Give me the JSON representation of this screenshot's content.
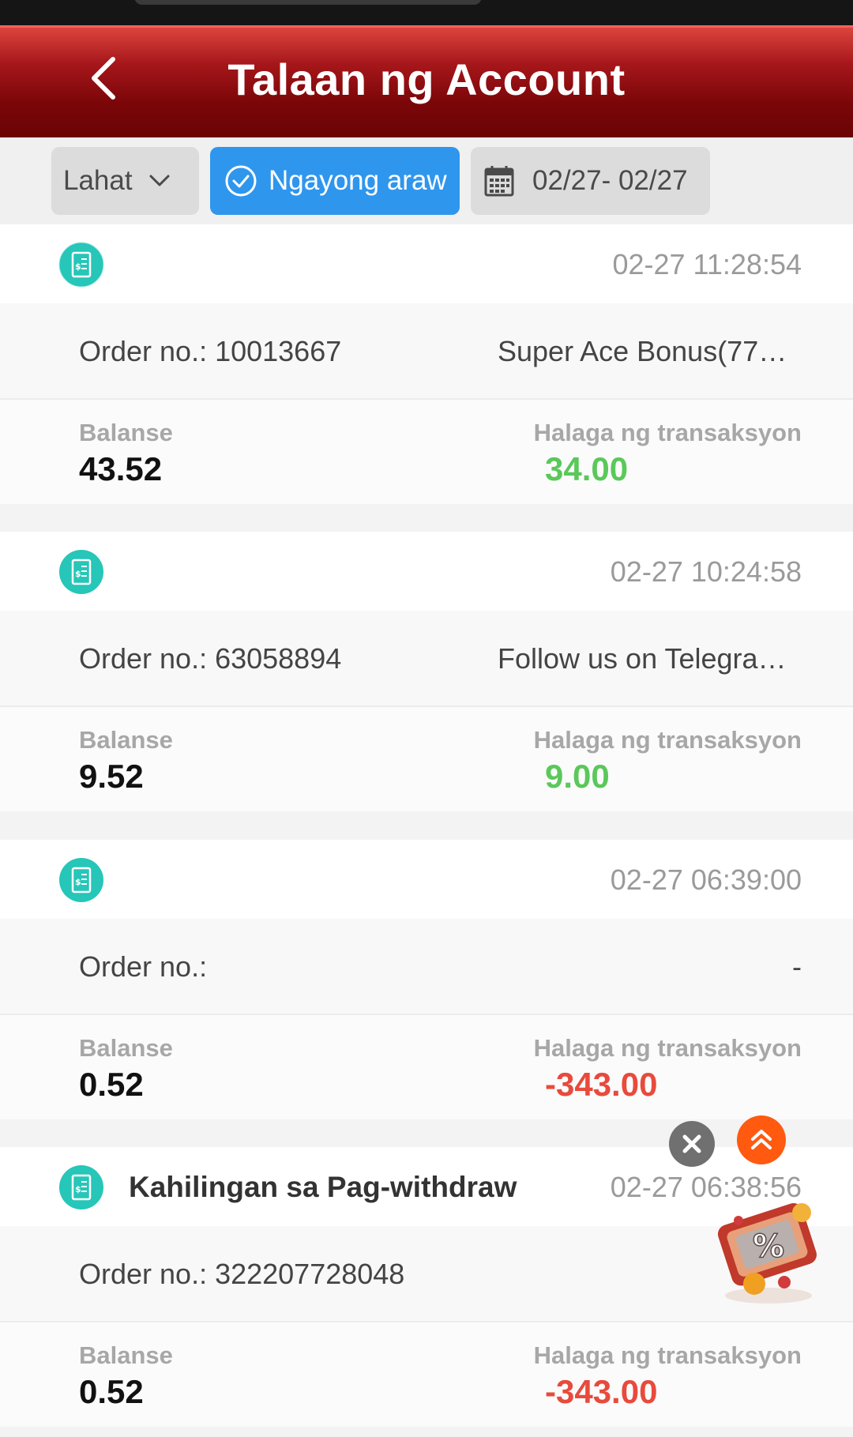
{
  "header": {
    "title": "Talaan ng Account"
  },
  "filters": {
    "category_label": "Lahat",
    "today_label": "Ngayong araw",
    "date_range": "02/27- 02/27"
  },
  "labels": {
    "order_prefix": "Order no.:",
    "balance": "Balanse",
    "amount": "Halaga ng transaksyon"
  },
  "records": [
    {
      "title": "",
      "time": "02-27 11:28:54",
      "order_no": "Order no.: 10013667",
      "description": "Super Ace Bonus(77…",
      "balance": "43.52",
      "amount": "34.00",
      "amount_type": "positive"
    },
    {
      "title": "",
      "time": "02-27 10:24:58",
      "order_no": "Order no.: 63058894",
      "description": "Follow us on Telegra…",
      "balance": "9.52",
      "amount": "9.00",
      "amount_type": "positive"
    },
    {
      "title": "",
      "time": "02-27 06:39:00",
      "order_no": "Order no.:",
      "description": "-",
      "balance": "0.52",
      "amount": "-343.00",
      "amount_type": "negative"
    },
    {
      "title": "Kahilingan sa Pag-withdraw",
      "time": "02-27 06:38:56",
      "order_no": "Order no.: 322207728048",
      "description": "",
      "balance": "0.52",
      "amount": "-343.00",
      "amount_type": "negative"
    }
  ],
  "colors": {
    "header_red": "#7a0608",
    "accent_blue": "#2f96ee",
    "positive_green": "#5ac85a",
    "negative_red": "#e84a3c",
    "icon_teal": "#26c6b8"
  },
  "icons": {
    "back": "chevron-left-icon",
    "dropdown": "chevron-down-icon",
    "today": "check-circle-icon",
    "calendar": "calendar-icon",
    "record": "receipt-icon",
    "close": "close-icon",
    "scroll_top": "double-chevron-up-icon",
    "promo": "discount-gift-icon"
  }
}
